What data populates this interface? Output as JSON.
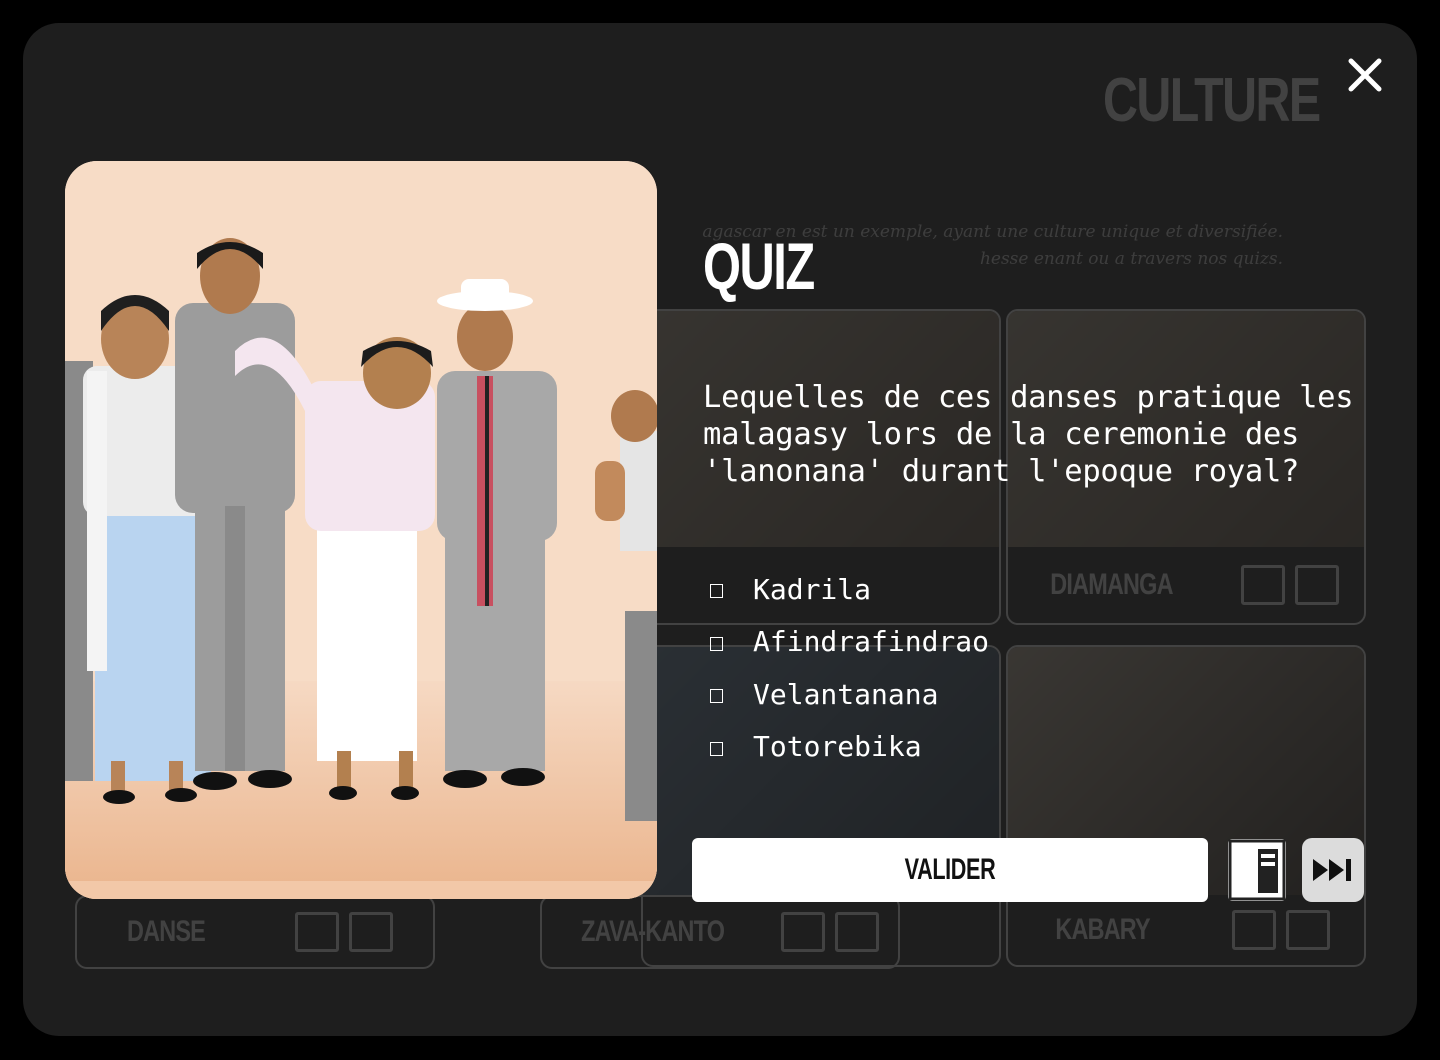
{
  "background_page": {
    "title": "CULTURE",
    "intro_line1": "agascar en est un exemple, ayant une culture unique et diversifiée.",
    "intro_line2": "hesse              enant ou a travers nos quizs.",
    "cards": [
      "DIAMANGA",
      "DANSE",
      "ZAVA-KANTO",
      "KABARY"
    ]
  },
  "quiz": {
    "title": "QUIZ",
    "question": "Lequelles de ces danses pratique les malagasy lors de la ceremonie des 'lanonana' durant l'epoque royal?",
    "options": [
      "Kadrila",
      "Afindrafindrao",
      "Velantanana",
      "Totorebika"
    ],
    "validate_label": "VALIDER"
  },
  "icons": {
    "close": "close-icon",
    "lesson": "book-icon",
    "skip": "skip-next-icon"
  },
  "colors": {
    "panel": "#1e1e1e",
    "illustration_background": "#f7dcc6"
  }
}
